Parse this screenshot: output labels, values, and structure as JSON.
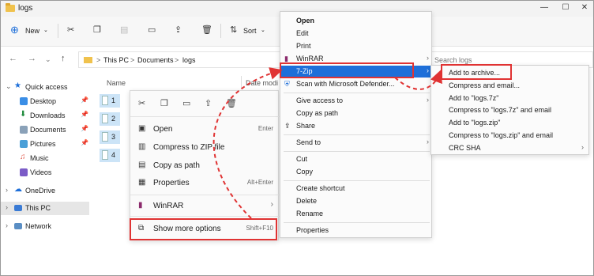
{
  "window": {
    "title": "logs",
    "controls": [
      "—",
      "☐",
      "✕"
    ]
  },
  "toolbar": {
    "new_label": "New",
    "sort_label": "Sort"
  },
  "address": {
    "crumbs": [
      "This PC",
      ">",
      "Documents",
      ">",
      "logs"
    ],
    "search_placeholder": "Search logs"
  },
  "nav_pane": {
    "items": [
      {
        "label": "Quick access"
      },
      {
        "label": "Desktop"
      },
      {
        "label": "Downloads"
      },
      {
        "label": "Documents"
      },
      {
        "label": "Pictures"
      },
      {
        "label": "Music"
      },
      {
        "label": "Videos"
      },
      {
        "label": "OneDrive"
      },
      {
        "label": "This PC"
      },
      {
        "label": "Network"
      }
    ]
  },
  "files": {
    "col_name": "Name",
    "col_date": "Date modi",
    "items": [
      "1",
      "2",
      "3",
      "4"
    ]
  },
  "compact_menu": {
    "items": [
      {
        "label": "Open",
        "shortcut": "Enter"
      },
      {
        "label": "Compress to ZIP file",
        "shortcut": ""
      },
      {
        "label": "Copy as path",
        "shortcut": ""
      },
      {
        "label": "Properties",
        "shortcut": "Alt+Enter"
      },
      {
        "label": "WinRAR",
        "shortcut": ""
      },
      {
        "label": "Show more options",
        "shortcut": "Shift+F10"
      }
    ]
  },
  "classic_menu": {
    "items": [
      {
        "label": "Open"
      },
      {
        "label": "Edit"
      },
      {
        "label": "Print"
      },
      {
        "label": "WinRAR"
      },
      {
        "label": "7-Zip"
      },
      {
        "label": "Scan with Microsoft Defender..."
      },
      {
        "label": "Give access to"
      },
      {
        "label": "Copy as path"
      },
      {
        "label": "Share"
      },
      {
        "label": "Send to"
      },
      {
        "label": "Cut"
      },
      {
        "label": "Copy"
      },
      {
        "label": "Create shortcut"
      },
      {
        "label": "Delete"
      },
      {
        "label": "Rename"
      },
      {
        "label": "Properties"
      }
    ]
  },
  "zip_submenu": {
    "items": [
      {
        "label": "Add to archive..."
      },
      {
        "label": "Compress and email..."
      },
      {
        "label": "Add to \"logs.7z\""
      },
      {
        "label": "Compress to \"logs.7z\" and email"
      },
      {
        "label": "Add to \"logs.zip\""
      },
      {
        "label": "Compress to \"logs.zip\" and email"
      },
      {
        "label": "CRC SHA"
      }
    ]
  },
  "colors": {
    "accent": "#1e6fd9",
    "highlight_box": "#e03333",
    "selection": "#cce4f7"
  }
}
